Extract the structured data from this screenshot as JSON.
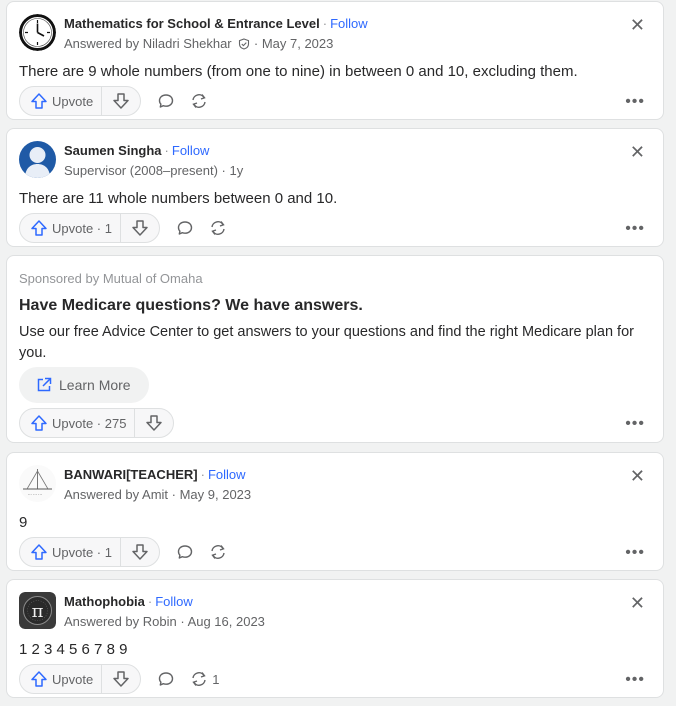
{
  "answers": [
    {
      "author": "Mathematics for School & Entrance Level",
      "follow": "Follow",
      "meta": "Answered by Niladri Shekhar",
      "meta_date": "· May 7, 2023",
      "text": "There are 9 whole numbers (from one to nine) in between 0 and 10, excluding them.",
      "upvote": "Upvote",
      "share_count": ""
    },
    {
      "author": "Saumen Singha",
      "follow": "Follow",
      "meta": "Supervisor (2008–present) · 1y",
      "text": "There are 11 whole numbers between 0 and 10.",
      "upvote": "Upvote · 1",
      "share_count": ""
    },
    {
      "author": "BANWARI[TEACHER]",
      "follow": "Follow",
      "meta": "Answered by Amit · May 9, 2023",
      "text": "9",
      "upvote": "Upvote · 1",
      "share_count": ""
    },
    {
      "author": "Mathophobia",
      "follow": "Follow",
      "meta": "Answered by Robin · Aug 16, 2023",
      "text": "1 2 3 4 5 6 7 8 9",
      "upvote": "Upvote",
      "share_count": "1"
    }
  ],
  "sponsored": {
    "by": "Sponsored by Mutual of Omaha",
    "title": "Have Medicare questions? We have answers.",
    "body": "Use our free Advice Center to get answers to your questions and find the right Medicare plan for you.",
    "cta": "Learn More",
    "upvote": "Upvote · 275"
  },
  "icons": {
    "close": "close-icon",
    "more": "more-icon",
    "upvote": "upvote-arrow-icon",
    "downvote": "downvote-arrow-icon",
    "comment": "comment-icon",
    "share": "share-icon",
    "external": "external-link-icon"
  },
  "colors": {
    "accent": "#2e69ff",
    "upvote_icon": "#2e69ff"
  }
}
